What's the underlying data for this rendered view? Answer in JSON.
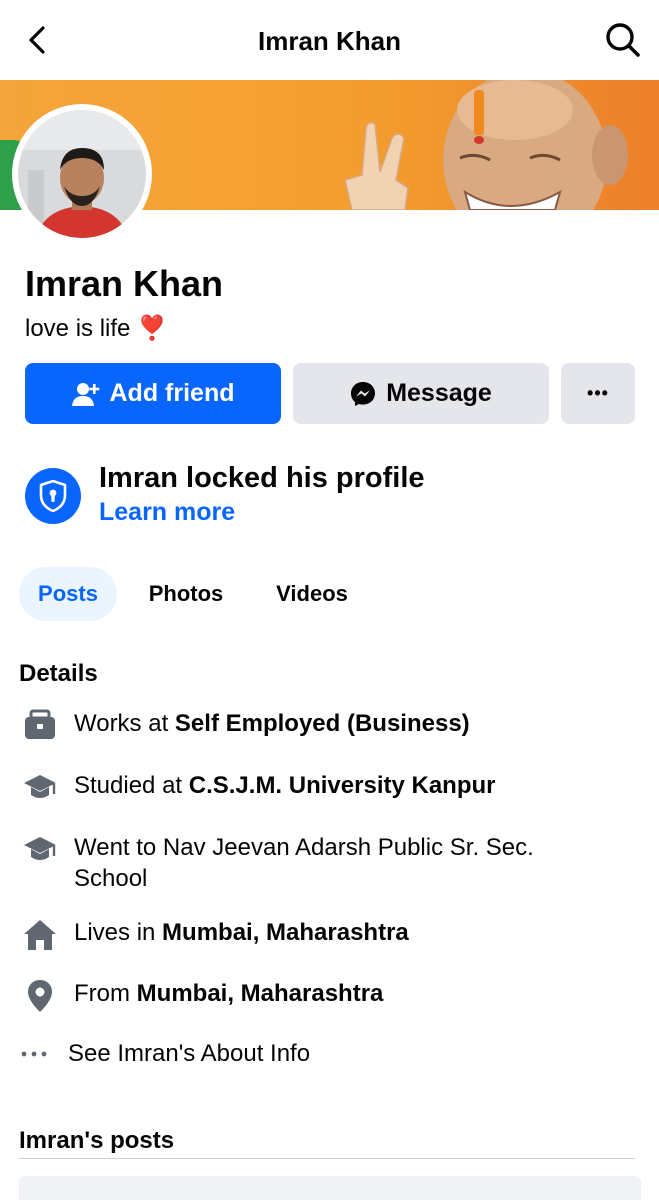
{
  "header": {
    "title": "Imran Khan",
    "back_icon": "chevron-left-icon",
    "search_icon": "search-icon"
  },
  "profile": {
    "name": "Imran Khan",
    "bio": "love is life",
    "bio_emoji": "❣️"
  },
  "actions": {
    "add_friend": "Add friend",
    "message": "Message",
    "more": "•••"
  },
  "locked": {
    "title": "Imran locked his profile",
    "link": "Learn more"
  },
  "tabs": [
    {
      "label": "Posts",
      "active": true
    },
    {
      "label": "Photos",
      "active": false
    },
    {
      "label": "Videos",
      "active": false
    }
  ],
  "details": {
    "heading": "Details",
    "items": [
      {
        "icon": "briefcase-icon",
        "prefix": "Works at ",
        "value": "Self Employed (Business)"
      },
      {
        "icon": "graduation-cap-icon",
        "prefix": "Studied at ",
        "value": "C.S.J.M. University Kanpur"
      },
      {
        "icon": "graduation-cap-icon",
        "prefix": "Went to Nav Jeevan Adarsh Public Sr. Sec. School",
        "value": ""
      },
      {
        "icon": "home-icon",
        "prefix": "Lives in ",
        "value": "Mumbai, Maharashtra"
      },
      {
        "icon": "location-pin-icon",
        "prefix": "From ",
        "value": "Mumbai, Maharashtra"
      }
    ],
    "see_more": "See Imran's About Info"
  },
  "posts": {
    "heading": "Imran's posts"
  },
  "colors": {
    "brand_blue": "#0866ff",
    "button_grey": "#e4e6eb",
    "tab_active_bg": "#ebf5ff"
  }
}
